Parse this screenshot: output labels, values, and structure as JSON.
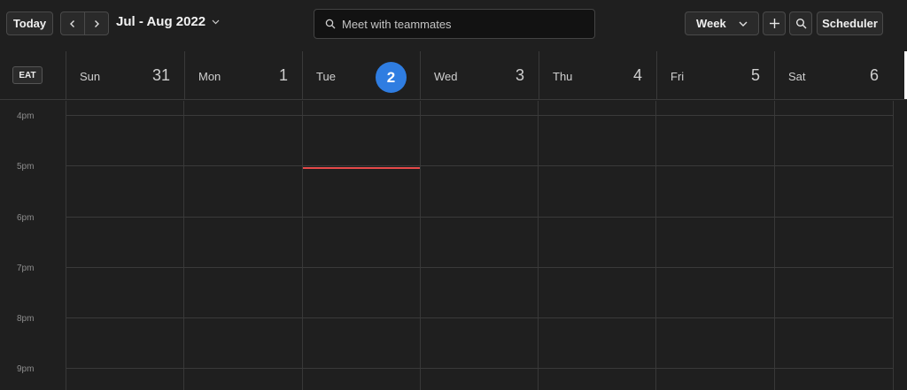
{
  "toolbar": {
    "today_label": "Today",
    "prev_icon": "chevron-left-icon",
    "next_icon": "chevron-right-icon",
    "period_label": "Jul - Aug 2022",
    "search_placeholder": "Meet with teammates",
    "view_label": "Week",
    "scheduler_label": "Scheduler"
  },
  "header": {
    "timezone": "EAT",
    "days": [
      {
        "name": "Sun",
        "num": "31"
      },
      {
        "name": "Mon",
        "num": "1"
      },
      {
        "name": "Tue",
        "num": "2",
        "today": true
      },
      {
        "name": "Wed",
        "num": "3"
      },
      {
        "name": "Thu",
        "num": "4"
      },
      {
        "name": "Fri",
        "num": "5"
      },
      {
        "name": "Sat",
        "num": "6"
      }
    ]
  },
  "grid": {
    "hours": [
      "4pm",
      "5pm",
      "6pm",
      "7pm",
      "8pm",
      "9pm"
    ]
  },
  "colors": {
    "accent": "#2f7de1",
    "now_line": "#e64a4a",
    "background": "#1f1f1f"
  }
}
